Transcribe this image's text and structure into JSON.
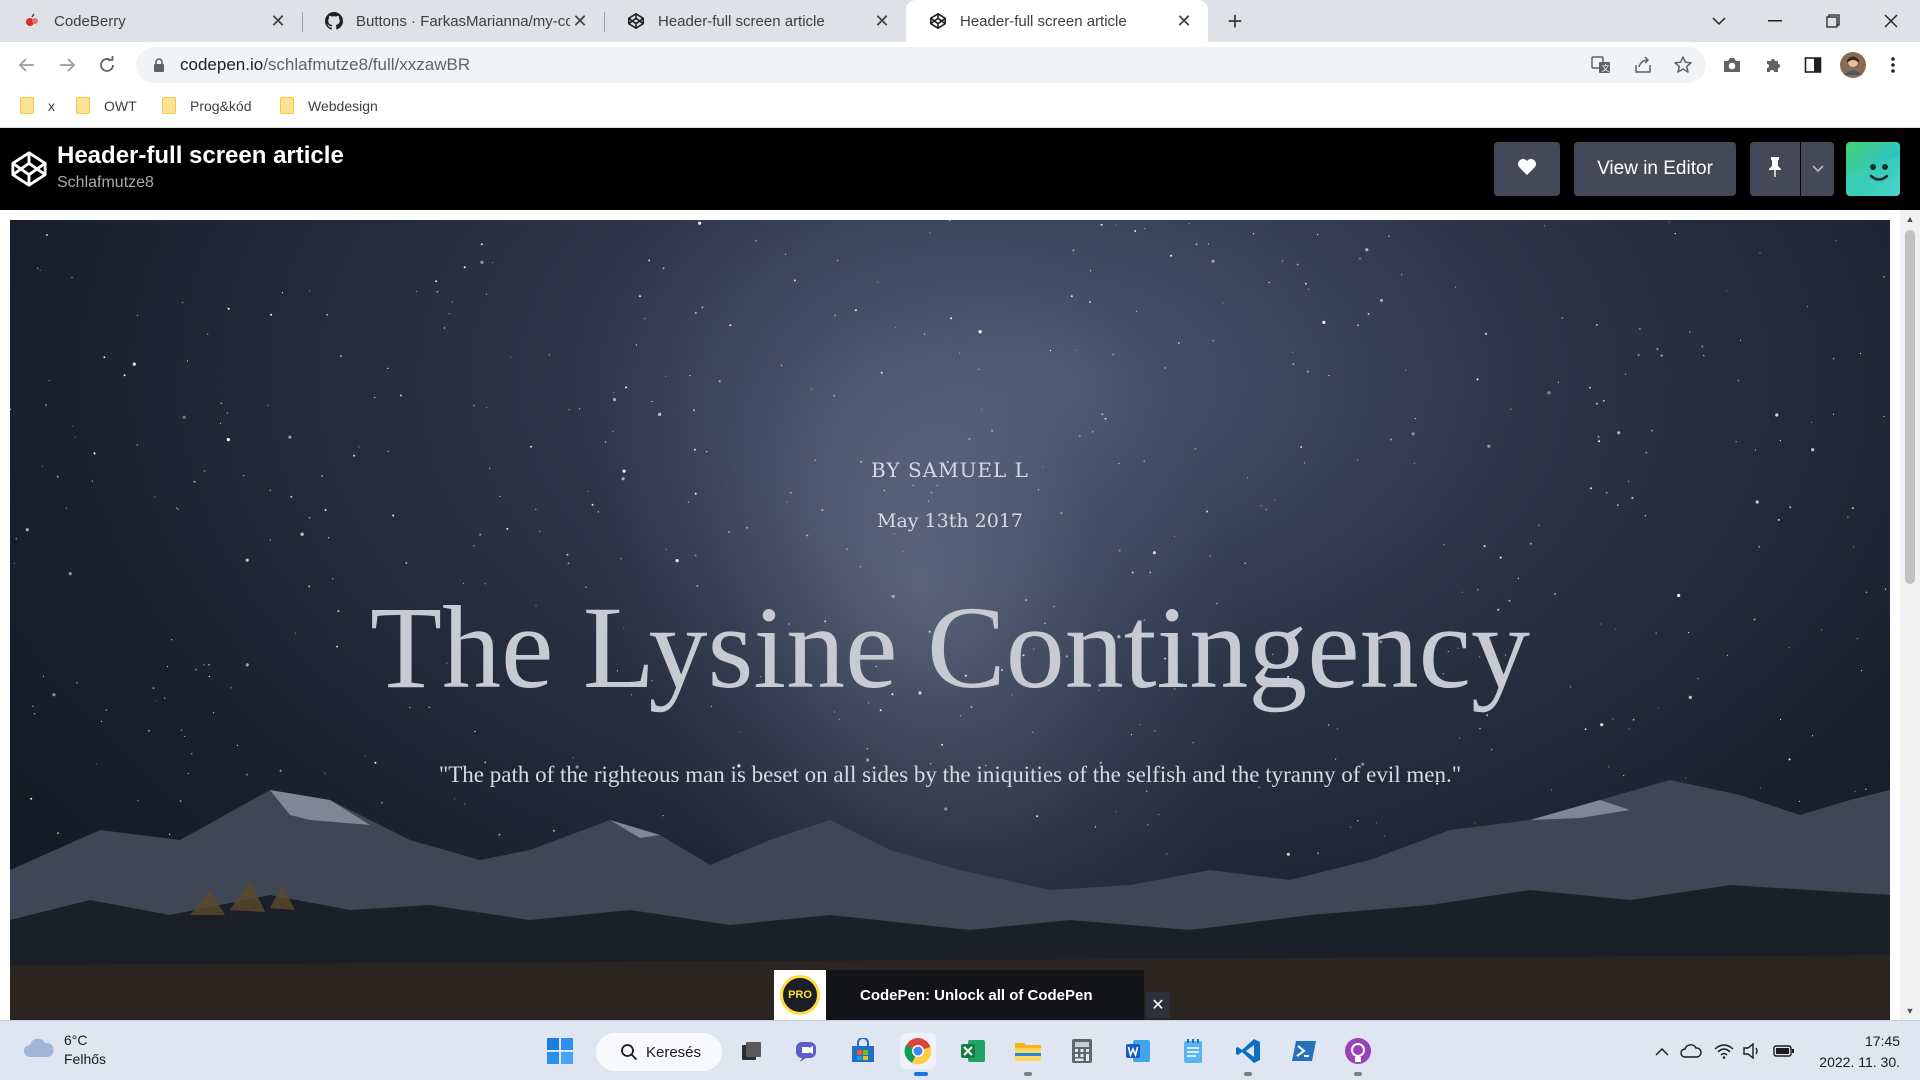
{
  "browser": {
    "tabs": [
      {
        "title": "CodeBerry",
        "active": false,
        "icon": "codeberry-icon"
      },
      {
        "title": "Buttons · FarkasMarianna/my-co",
        "active": false,
        "icon": "github-icon"
      },
      {
        "title": "Header-full screen article",
        "active": false,
        "icon": "codepen-icon"
      },
      {
        "title": "Header-full screen article",
        "active": true,
        "icon": "codepen-icon"
      }
    ],
    "url_host": "codepen.io",
    "url_path": "/schlafmutze8/full/xxzawBR",
    "bookmarks": [
      {
        "label": "x"
      },
      {
        "label": "OWT"
      },
      {
        "label": "Prog&kód"
      },
      {
        "label": "Webdesign"
      }
    ]
  },
  "codepen": {
    "title": "Header-full screen article",
    "author": "Schlafmutze8",
    "view_in_editor": "View in Editor"
  },
  "article": {
    "byline": "BY SAMUEL L",
    "date": "May 13th 2017",
    "headline": "The Lysine Contingency",
    "quote": "\"The path of the righteous man is beset on all sides by the iniquities of the selfish and the tyranny of evil men.\""
  },
  "promo": {
    "badge": "PRO",
    "text": "CodePen: Unlock all of CodePen",
    "close": "✕"
  },
  "taskbar": {
    "weather_temp": "6°C",
    "weather_desc": "Felhős",
    "search_label": "Keresés",
    "time": "17:45",
    "date": "2022. 11. 30."
  }
}
